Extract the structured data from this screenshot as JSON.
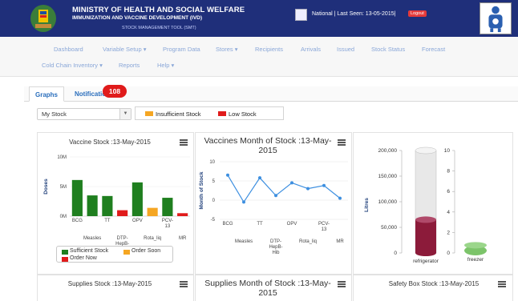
{
  "header": {
    "org_line1": "MINISTRY OF HEALTH AND SOCIAL WELFARE",
    "org_line2": "IMMUNIZATION AND VACCINE DEVELOPMENT (IVD)",
    "org_line3": "STOCK MANAGEMENT TOOL (SMT)",
    "last_seen": "National | Last Seen: 13-05-2015|",
    "logout": "Logout"
  },
  "nav": {
    "row1": [
      "Dashboard",
      "Variable Setup ▾",
      "Program Data",
      "Stores ▾",
      "Recipients",
      "Arrivals",
      "Issued",
      "Stock Status",
      "Forecast"
    ],
    "row2": [
      "Cold Chain Inventory ▾",
      "Reports",
      "Help ▾"
    ]
  },
  "tabs": {
    "graphs": "Graphs",
    "notifications": "Notifications",
    "badge": "108"
  },
  "select": {
    "value": "My Stock"
  },
  "stock_legend": {
    "insufficient": "Insufficient Stock",
    "low": "Low Stock"
  },
  "colors": {
    "green": "#1f7f1f",
    "orange": "#f5a623",
    "red": "#e01b1b",
    "line": "#3d8fe0",
    "header": "#1f2f7a",
    "maroon": "#8c1b3a"
  },
  "chart_data": [
    {
      "type": "bar",
      "title": "Vaccine Stock :13-May-2015",
      "ylabel": "Doses",
      "categories": [
        "BCG",
        "Measles",
        "TT",
        "DTP-HepB-Hib",
        "OPV",
        "Rota_liq",
        "PCV-13",
        "MR"
      ],
      "colors": [
        "#1f7f1f",
        "#1f7f1f",
        "#1f7f1f",
        "#e01b1b",
        "#1f7f1f",
        "#f5a623",
        "#1f7f1f",
        "#e01b1b"
      ],
      "values": [
        6.1,
        3.5,
        3.4,
        1.0,
        5.7,
        1.4,
        3.1,
        0.5
      ],
      "unit": "M",
      "ylim": [
        0,
        10
      ],
      "yticks": [
        "0M",
        "5M",
        "10M"
      ],
      "legend": [
        "Sufficient Stock",
        "Order Soon",
        "Order Now"
      ]
    },
    {
      "type": "line",
      "title": "Vaccines Month of Stock :13-May-2015",
      "ylabel": "Month of Stock",
      "categories": [
        "BCG",
        "Measles",
        "TT",
        "DTP-HepB-Hib",
        "OPV",
        "Rota_liq",
        "PCV-13",
        "MR"
      ],
      "values": [
        6.5,
        -0.5,
        5.8,
        1.2,
        4.5,
        3.0,
        3.8,
        0.5
      ],
      "ylim": [
        -5,
        10
      ],
      "yticks": [
        "-5",
        "0",
        "5",
        "10"
      ]
    },
    {
      "type": "bar",
      "title": "",
      "ylabel": "Litres",
      "categories": [
        "refrigerator",
        "freezer"
      ],
      "values": [
        {
          "total": 200000,
          "used": 65000
        },
        {
          "total": 10,
          "used": 0.6
        }
      ],
      "ylim_left": [
        0,
        200000
      ],
      "yticks_left": [
        "0",
        "50,000",
        "100,000",
        "150,000",
        "200,000"
      ],
      "ylim_right": [
        0,
        10
      ],
      "yticks_right": [
        "0",
        "2",
        "4",
        "6",
        "8",
        "10"
      ]
    }
  ],
  "bottom_panels": [
    "Supplies Stock :13-May-2015",
    "Supplies Month of Stock :13-May-2015",
    "Safety Box Stock :13-May-2015"
  ]
}
